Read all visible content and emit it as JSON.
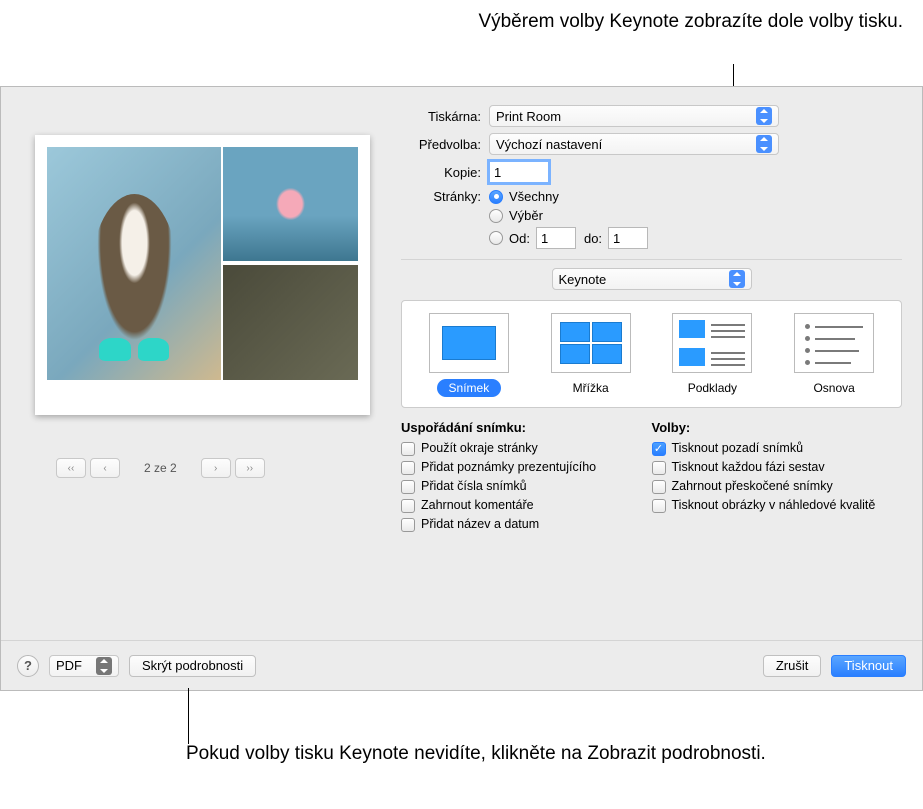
{
  "callouts": {
    "top": "Výběrem volby Keynote zobrazíte dole volby tisku.",
    "bottom": "Pokud volby tisku Keynote nevidíte, klikněte na Zobrazit podrobnosti."
  },
  "form": {
    "printer_label": "Tiskárna:",
    "printer_value": "Print Room",
    "preset_label": "Předvolba:",
    "preset_value": "Výchozí nastavení",
    "copies_label": "Kopie:",
    "copies_value": "1",
    "pages_label": "Stránky:",
    "pages_all": "Všechny",
    "pages_selection": "Výběr",
    "pages_from": "Od:",
    "pages_from_value": "1",
    "pages_to": "do:",
    "pages_to_value": "1",
    "app_value": "Keynote"
  },
  "layouts": {
    "slide": "Snímek",
    "grid": "Mřížka",
    "handouts": "Podklady",
    "outline": "Osnova"
  },
  "slide_arrangement": {
    "heading": "Uspořádání snímku:",
    "margins": "Použít okraje stránky",
    "notes": "Přidat poznámky prezentujícího",
    "numbers": "Přidat čísla snímků",
    "comments": "Zahrnout komentáře",
    "namedate": "Přidat název a datum"
  },
  "options": {
    "heading": "Volby:",
    "backgrounds": "Tisknout pozadí snímků",
    "builds": "Tisknout každou fázi sestav",
    "skipped": "Zahrnout přeskočené snímky",
    "draft": "Tisknout obrázky v náhledové kvalitě"
  },
  "pager": {
    "label": "2 ze 2"
  },
  "bottom": {
    "pdf": "PDF",
    "hide": "Skrýt podrobnosti",
    "cancel": "Zrušit",
    "print": "Tisknout"
  },
  "icons": {
    "help": "?",
    "first": "‹‹",
    "prev": "‹",
    "next": "›",
    "last": "››",
    "dd": "⌄"
  }
}
